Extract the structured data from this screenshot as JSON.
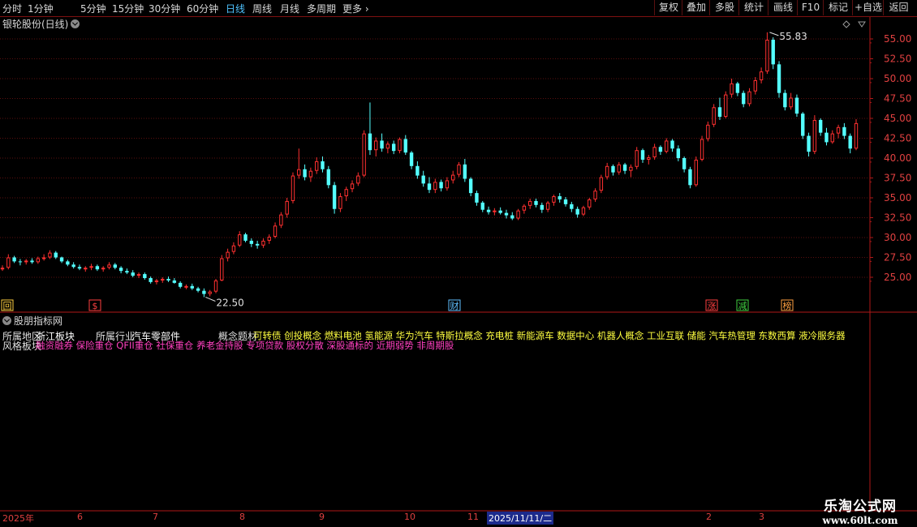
{
  "toolbar": {
    "periods": [
      "分时",
      "1分钟",
      "5分钟",
      "15分钟",
      "30分钟",
      "60分钟",
      "日线",
      "周线",
      "月线",
      "多周期",
      "更多"
    ],
    "active_period": "日线",
    "buttons": [
      "复权",
      "叠加",
      "多股",
      "统计",
      "画线",
      "F10",
      "标记",
      "+自选",
      "返回"
    ]
  },
  "chart": {
    "title": "银轮股份(日线)",
    "high_label": "55.83",
    "low_label": "22.50",
    "price_ticks": [
      "55.00",
      "52.50",
      "50.00",
      "47.50",
      "45.00",
      "42.50",
      "40.00",
      "37.50",
      "35.00",
      "32.50",
      "30.00",
      "27.50",
      "25.00"
    ],
    "markers": [
      {
        "text": "回",
        "color": "#ffd040"
      },
      {
        "text": "$",
        "color": "#ff4040"
      },
      {
        "text": "财",
        "color": "#60c0ff"
      },
      {
        "text": "涨",
        "color": "#ff4040"
      },
      {
        "text": "减",
        "color": "#40d040"
      },
      {
        "text": "榜",
        "color": "#ffa040"
      }
    ],
    "candles": [
      [
        26.0,
        26.5,
        25.8,
        26.2
      ],
      [
        26.2,
        27.9,
        26.0,
        27.5
      ],
      [
        27.5,
        27.7,
        26.8,
        27.0
      ],
      [
        27.0,
        27.3,
        26.5,
        26.9
      ],
      [
        26.9,
        27.3,
        26.6,
        27.1
      ],
      [
        27.1,
        27.4,
        26.7,
        26.9
      ],
      [
        26.9,
        27.6,
        26.7,
        27.4
      ],
      [
        27.4,
        27.9,
        27.1,
        27.5
      ],
      [
        27.5,
        28.4,
        27.3,
        28.1
      ],
      [
        28.1,
        28.3,
        27.3,
        27.5
      ],
      [
        27.5,
        27.6,
        26.8,
        27.0
      ],
      [
        27.0,
        27.2,
        26.4,
        26.6
      ],
      [
        26.6,
        26.9,
        26.1,
        26.3
      ],
      [
        26.3,
        26.6,
        25.9,
        26.1
      ],
      [
        26.1,
        26.4,
        25.7,
        26.2
      ],
      [
        26.2,
        26.7,
        25.9,
        26.4
      ],
      [
        26.4,
        26.6,
        25.8,
        26.0
      ],
      [
        26.0,
        26.4,
        25.7,
        26.2
      ],
      [
        26.2,
        26.9,
        26.0,
        26.6
      ],
      [
        26.6,
        26.8,
        26.0,
        26.2
      ],
      [
        26.2,
        26.4,
        25.5,
        25.8
      ],
      [
        25.8,
        26.1,
        25.4,
        25.6
      ],
      [
        25.6,
        25.9,
        25.0,
        25.2
      ],
      [
        25.2,
        25.6,
        24.9,
        25.4
      ],
      [
        25.4,
        25.6,
        24.7,
        24.9
      ],
      [
        24.9,
        25.1,
        24.2,
        24.4
      ],
      [
        24.4,
        24.8,
        24.1,
        24.6
      ],
      [
        24.6,
        25.0,
        24.3,
        24.8
      ],
      [
        24.8,
        25.1,
        24.4,
        24.6
      ],
      [
        24.6,
        24.9,
        24.2,
        24.3
      ],
      [
        24.3,
        24.5,
        23.6,
        23.8
      ],
      [
        23.8,
        24.1,
        23.5,
        23.9
      ],
      [
        23.9,
        24.2,
        23.4,
        23.6
      ],
      [
        23.6,
        23.8,
        23.1,
        23.3
      ],
      [
        23.3,
        23.6,
        22.5,
        22.9
      ],
      [
        22.9,
        23.4,
        22.6,
        23.2
      ],
      [
        23.2,
        24.8,
        23.0,
        24.6
      ],
      [
        24.6,
        27.8,
        24.5,
        27.4
      ],
      [
        27.4,
        28.6,
        27.0,
        28.2
      ],
      [
        28.2,
        29.4,
        27.9,
        29.0
      ],
      [
        29.0,
        30.8,
        28.8,
        30.4
      ],
      [
        30.4,
        30.6,
        29.4,
        29.6
      ],
      [
        29.6,
        29.9,
        28.8,
        29.2
      ],
      [
        29.2,
        29.6,
        28.6,
        29.0
      ],
      [
        29.0,
        29.9,
        28.7,
        29.6
      ],
      [
        29.6,
        30.4,
        29.2,
        30.1
      ],
      [
        30.1,
        31.9,
        29.9,
        31.5
      ],
      [
        31.5,
        33.2,
        31.2,
        32.9
      ],
      [
        32.9,
        35.0,
        32.5,
        34.6
      ],
      [
        34.6,
        38.2,
        34.3,
        37.8
      ],
      [
        37.8,
        41.2,
        37.4,
        38.6
      ],
      [
        38.6,
        39.2,
        37.2,
        37.6
      ],
      [
        37.6,
        38.8,
        37.0,
        38.4
      ],
      [
        38.4,
        40.1,
        38.0,
        39.6
      ],
      [
        39.6,
        40.2,
        38.2,
        38.6
      ],
      [
        38.6,
        39.0,
        36.2,
        36.6
      ],
      [
        36.6,
        37.0,
        33.0,
        33.6
      ],
      [
        33.6,
        35.6,
        33.2,
        35.2
      ],
      [
        35.2,
        36.4,
        34.6,
        36.1
      ],
      [
        36.1,
        37.2,
        35.7,
        36.8
      ],
      [
        36.8,
        38.2,
        36.5,
        37.8
      ],
      [
        37.8,
        43.5,
        37.6,
        43.1
      ],
      [
        43.1,
        47.0,
        40.4,
        41.0
      ],
      [
        41.0,
        42.6,
        40.2,
        42.2
      ],
      [
        42.2,
        43.1,
        40.8,
        41.2
      ],
      [
        41.2,
        42.1,
        40.6,
        41.8
      ],
      [
        41.8,
        42.2,
        40.5,
        40.9
      ],
      [
        40.9,
        42.6,
        40.6,
        42.4
      ],
      [
        42.4,
        42.9,
        40.4,
        40.7
      ],
      [
        40.7,
        40.9,
        38.6,
        39.0
      ],
      [
        39.0,
        39.6,
        37.4,
        37.8
      ],
      [
        37.8,
        38.4,
        36.4,
        36.8
      ],
      [
        36.8,
        37.6,
        35.6,
        36.0
      ],
      [
        36.0,
        37.4,
        35.6,
        37.0
      ],
      [
        37.0,
        37.3,
        35.8,
        36.2
      ],
      [
        36.2,
        37.6,
        35.9,
        37.2
      ],
      [
        37.2,
        38.4,
        36.8,
        37.9
      ],
      [
        37.9,
        39.5,
        37.6,
        39.2
      ],
      [
        39.2,
        39.9,
        37.0,
        37.4
      ],
      [
        37.4,
        37.6,
        35.2,
        35.6
      ],
      [
        35.6,
        35.9,
        34.0,
        34.4
      ],
      [
        34.4,
        34.6,
        33.2,
        33.5
      ],
      [
        33.5,
        33.9,
        32.9,
        33.2
      ],
      [
        33.2,
        33.7,
        32.8,
        33.4
      ],
      [
        33.4,
        33.8,
        32.9,
        33.1
      ],
      [
        33.1,
        33.5,
        32.4,
        32.8
      ],
      [
        32.8,
        33.2,
        32.2,
        32.4
      ],
      [
        32.4,
        33.6,
        32.2,
        33.4
      ],
      [
        33.4,
        34.2,
        33.0,
        34.0
      ],
      [
        34.0,
        34.9,
        33.6,
        34.6
      ],
      [
        34.6,
        34.9,
        33.8,
        34.1
      ],
      [
        34.1,
        34.4,
        33.1,
        33.5
      ],
      [
        33.5,
        34.6,
        33.2,
        34.4
      ],
      [
        34.4,
        35.4,
        34.0,
        35.2
      ],
      [
        35.2,
        35.6,
        34.4,
        34.8
      ],
      [
        34.8,
        35.1,
        33.9,
        34.2
      ],
      [
        34.2,
        34.5,
        33.2,
        33.6
      ],
      [
        33.6,
        33.9,
        32.5,
        32.9
      ],
      [
        32.9,
        34.0,
        32.7,
        33.8
      ],
      [
        33.8,
        35.0,
        33.5,
        34.8
      ],
      [
        34.8,
        36.2,
        34.5,
        35.9
      ],
      [
        35.9,
        37.9,
        35.6,
        37.6
      ],
      [
        37.6,
        39.4,
        37.3,
        39.0
      ],
      [
        39.0,
        39.2,
        37.8,
        38.2
      ],
      [
        38.2,
        39.5,
        37.9,
        39.2
      ],
      [
        39.2,
        39.4,
        38.0,
        38.4
      ],
      [
        38.4,
        39.2,
        37.6,
        38.9
      ],
      [
        38.9,
        41.4,
        38.6,
        41.0
      ],
      [
        41.0,
        41.2,
        39.4,
        39.8
      ],
      [
        39.8,
        40.4,
        39.2,
        40.1
      ],
      [
        40.1,
        41.8,
        39.8,
        41.4
      ],
      [
        41.4,
        41.6,
        40.4,
        40.8
      ],
      [
        40.8,
        42.5,
        40.6,
        42.2
      ],
      [
        42.2,
        42.4,
        40.8,
        41.2
      ],
      [
        41.2,
        41.6,
        39.6,
        40.0
      ],
      [
        40.0,
        40.2,
        38.2,
        38.6
      ],
      [
        38.6,
        38.9,
        36.2,
        36.6
      ],
      [
        36.6,
        40.2,
        36.4,
        39.8
      ],
      [
        39.8,
        42.8,
        39.6,
        42.4
      ],
      [
        42.4,
        44.6,
        42.1,
        44.2
      ],
      [
        44.2,
        46.8,
        43.9,
        46.4
      ],
      [
        46.4,
        47.6,
        44.8,
        45.2
      ],
      [
        45.2,
        48.4,
        45.0,
        48.0
      ],
      [
        48.0,
        50.0,
        47.6,
        49.4
      ],
      [
        49.4,
        49.6,
        47.8,
        48.2
      ],
      [
        48.2,
        48.5,
        46.4,
        46.8
      ],
      [
        46.8,
        48.8,
        46.5,
        48.4
      ],
      [
        48.4,
        50.2,
        48.0,
        49.8
      ],
      [
        49.8,
        51.4,
        49.4,
        50.9
      ],
      [
        50.9,
        55.83,
        50.6,
        54.9
      ],
      [
        54.9,
        55.2,
        51.2,
        51.8
      ],
      [
        51.8,
        52.2,
        47.6,
        48.2
      ],
      [
        48.2,
        48.6,
        46.0,
        46.4
      ],
      [
        46.4,
        48.2,
        46.1,
        47.6
      ],
      [
        47.6,
        48.0,
        45.2,
        45.6
      ],
      [
        45.6,
        45.8,
        42.4,
        42.8
      ],
      [
        42.8,
        43.2,
        40.2,
        40.8
      ],
      [
        40.8,
        45.4,
        40.5,
        44.8
      ],
      [
        44.8,
        45.0,
        42.8,
        43.2
      ],
      [
        43.2,
        43.8,
        41.6,
        42.0
      ],
      [
        42.0,
        43.5,
        41.8,
        43.1
      ],
      [
        43.1,
        44.2,
        42.5,
        43.9
      ],
      [
        43.9,
        44.4,
        42.4,
        42.8
      ],
      [
        42.8,
        43.1,
        40.6,
        41.2
      ],
      [
        41.2,
        44.9,
        41.0,
        44.4
      ]
    ]
  },
  "indicator_panel": {
    "title": "股朋指标网",
    "row1_label_region": "所属地区",
    "row1_value_region": "浙江板块",
    "row1_label_industry": "所属行业",
    "row1_value_industry": "汽车零部件",
    "row1_label_concept": "概念题材",
    "row1_value_concept": "可转债 创投概念 燃料电池 氢能源 华为汽车 特斯拉概念 充电桩 新能源车 数据中心 机器人概念 工业互联 储能 汽车热管理 东数西算 液冷服务器",
    "row2_label_style": "风格板块",
    "row2_value_style": "融资融券 保险重仓 QFII重仓 社保重仓 养老金持股 专项贷款 股权分散 深股通标的 近期弱势 非周期股"
  },
  "date_axis": {
    "labels": [
      "2025年",
      "6",
      "7",
      "8",
      "9",
      "10",
      "11",
      "2",
      "3"
    ],
    "selected": "2025/11/11/二"
  },
  "watermark": {
    "line1": "乐淘公式网",
    "line2": "www.60lt.com"
  },
  "colors": {
    "up": "#ff3030",
    "down": "#54ffff",
    "grid": "#5a0f0f",
    "concept": "#ffff40",
    "style": "#ff40c0"
  }
}
